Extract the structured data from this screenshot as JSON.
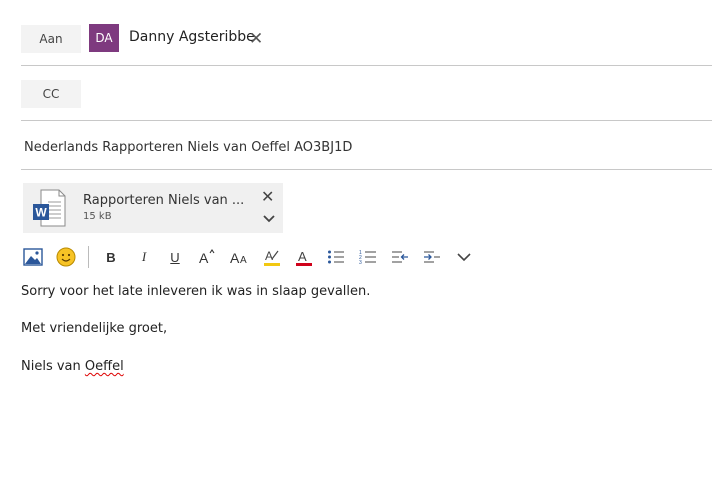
{
  "to": {
    "label": "Aan",
    "recipient": {
      "initials": "DA",
      "name": "Danny Agsteribbe",
      "avatar_color": "#7e3a7f"
    }
  },
  "cc": {
    "label": "CC"
  },
  "subject": "Nederlands Rapporteren Niels van Oeffel AO3BJ1D",
  "attachment": {
    "name": "Rapporteren Niels van ...",
    "size": "15 kB",
    "icon": "word-document-icon"
  },
  "toolbar": {
    "items": [
      "insert-picture-icon",
      "emoji-icon",
      "bold",
      "italic",
      "underline",
      "font-size-increase",
      "font-size",
      "highlight",
      "font-color",
      "bullets",
      "numbering",
      "decrease-indent",
      "increase-indent",
      "more"
    ],
    "bold_label": "B",
    "italic_label": "I",
    "underline_label": "U",
    "highlight_color": "#f2c811",
    "font_color": "#d0021b"
  },
  "body": {
    "line1": "Sorry voor het late inleveren ik was in slaap gevallen.",
    "line2": "Met vriendelijke groet,",
    "line3_prefix": "Niels van ",
    "line3_misspelled": "Oeffel"
  }
}
